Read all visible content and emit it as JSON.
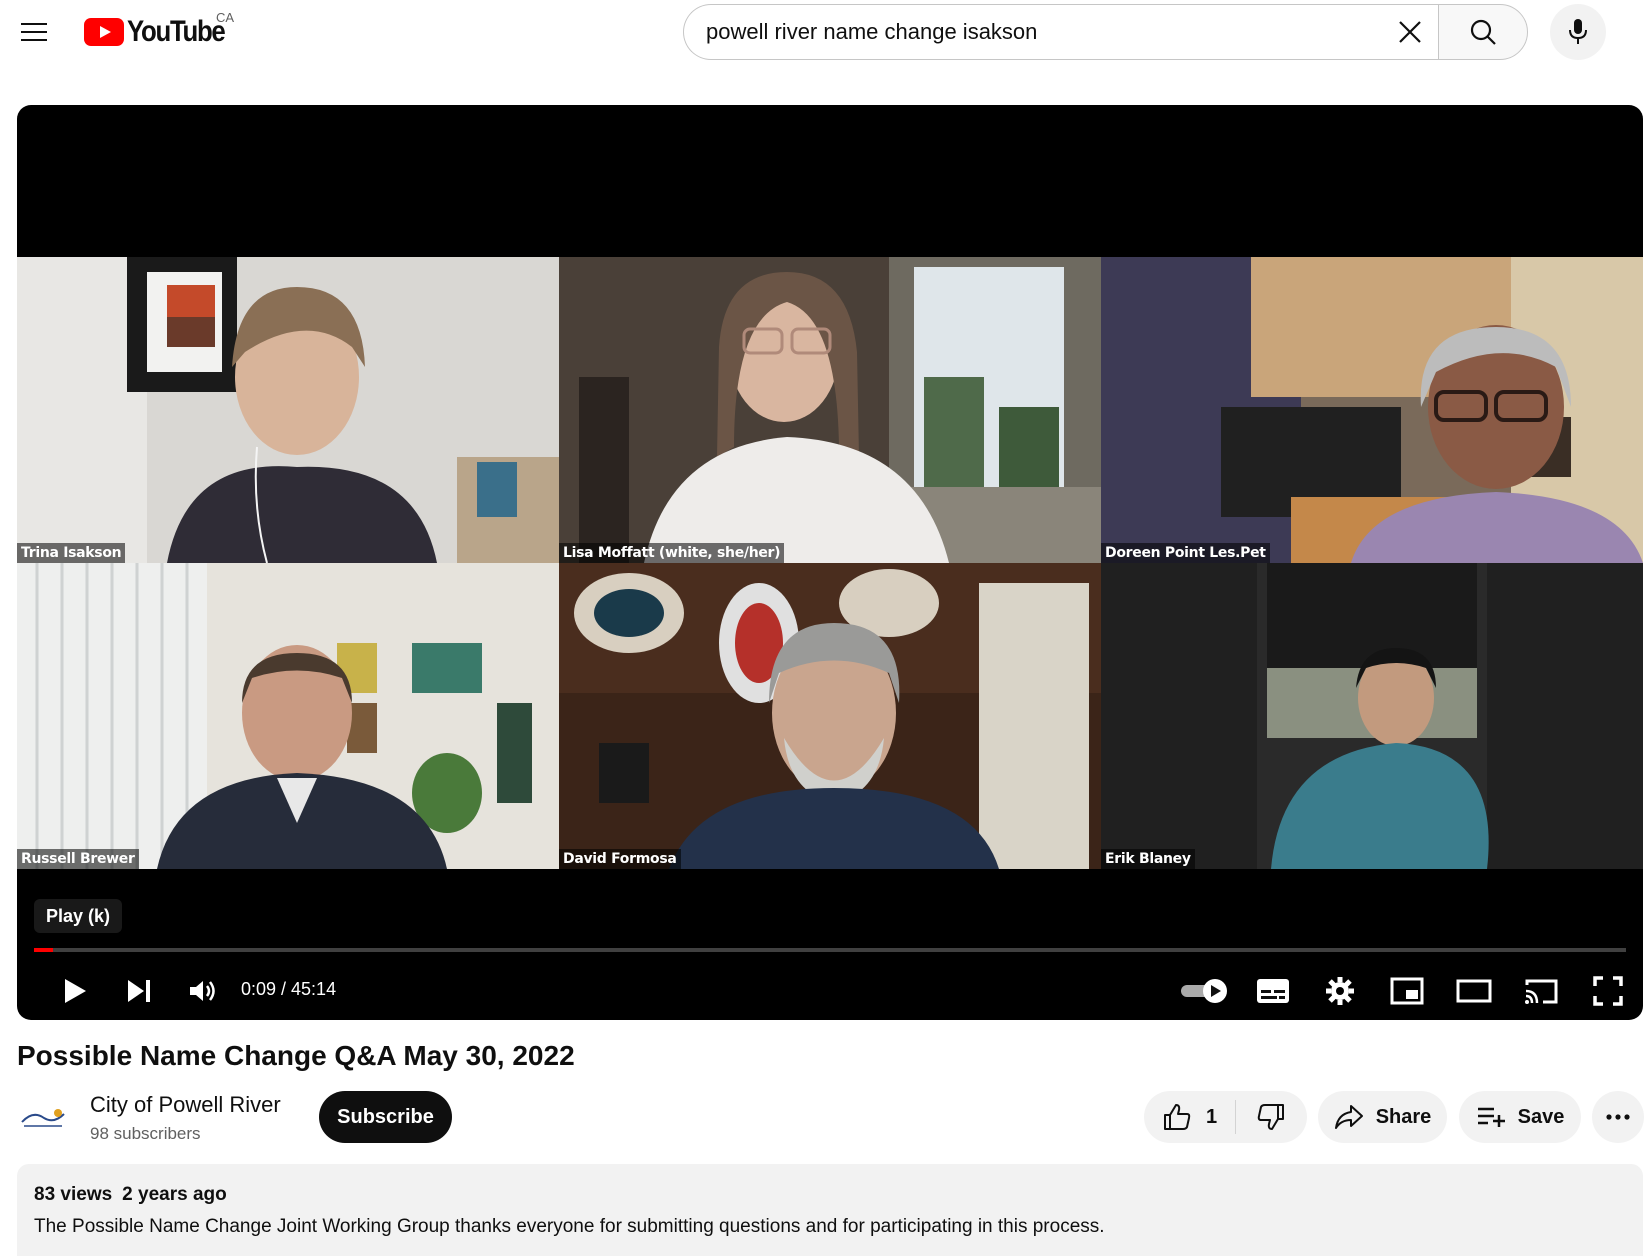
{
  "header": {
    "logo_text": "YouTube",
    "country": "CA",
    "search_value": "powell river name change isakson"
  },
  "player": {
    "tooltip": "Play (k)",
    "time": "0:09 / 45:14",
    "progress_fraction": 0.012,
    "participants": [
      {
        "name": "Trina Isakson"
      },
      {
        "name": "Lisa Moffatt (white, she/her)"
      },
      {
        "name": "Doreen Point Les.Pet"
      },
      {
        "name": "Russell Brewer"
      },
      {
        "name": "David Formosa"
      },
      {
        "name": "Erik Blaney"
      }
    ]
  },
  "video": {
    "title": "Possible Name Change Q&A May 30, 2022",
    "channel_name": "City of Powell River",
    "subscribers": "98 subscribers",
    "subscribe_label": "Subscribe",
    "like_count": "1",
    "share_label": "Share",
    "save_label": "Save",
    "views": "83 views",
    "age": "2 years ago",
    "description": "The Possible Name Change Joint Working Group thanks everyone for submitting questions and for participating in this process."
  },
  "colors": {
    "brand_red": "#ff0000",
    "text_primary": "#0f0f0f",
    "text_secondary": "#606060",
    "chip_bg": "#f2f2f2"
  }
}
